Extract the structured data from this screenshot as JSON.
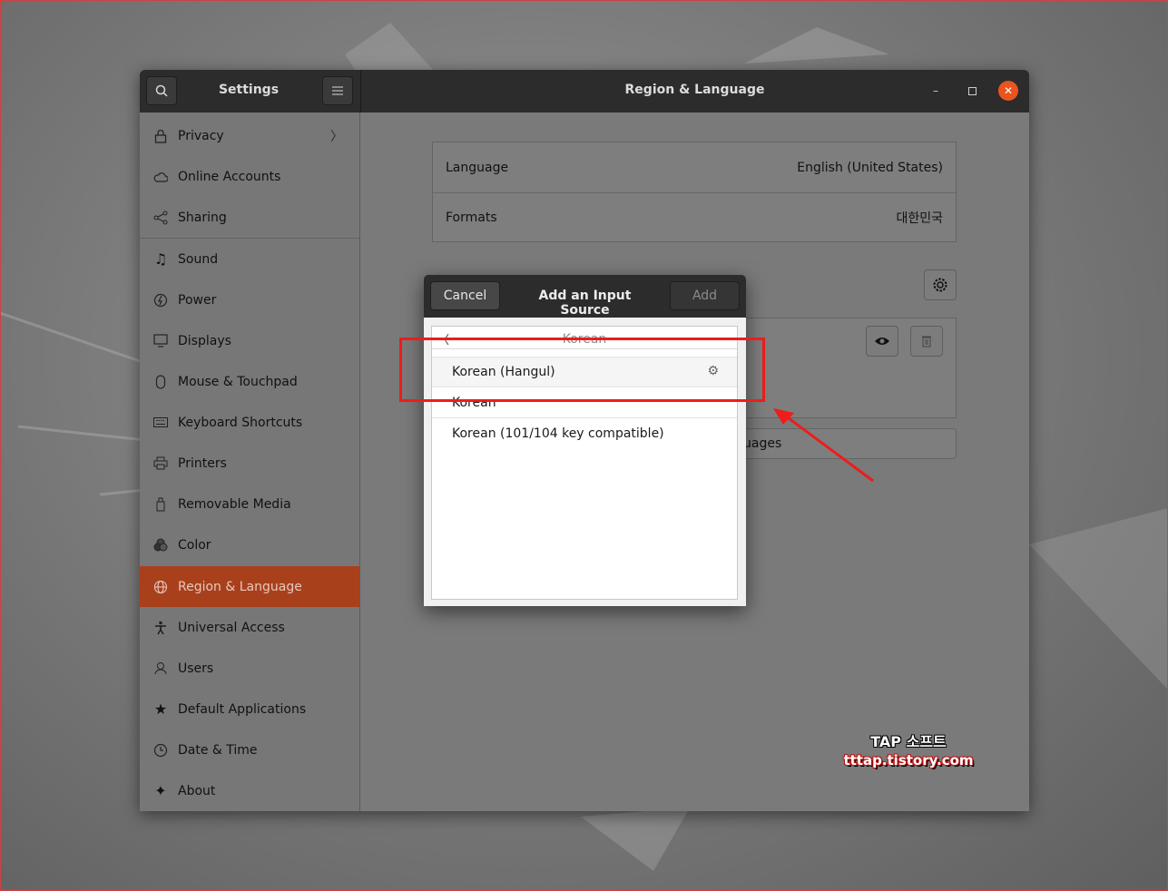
{
  "settings_window": {
    "sidebar_title": "Settings",
    "panel_title": "Region & Language",
    "window_controls": {
      "minimize_icon": "minimize-icon",
      "maximize_icon": "maximize-icon",
      "close_icon": "close-icon",
      "accent_color": "#e9541f"
    }
  },
  "sidebar": {
    "items": [
      {
        "label": "Privacy",
        "icon": "lock-icon",
        "has_chevron": true
      },
      {
        "label": "Online Accounts",
        "icon": "cloud-icon"
      },
      {
        "label": "Sharing",
        "icon": "share-icon"
      },
      {
        "label": "Sound",
        "icon": "music-note-icon"
      },
      {
        "label": "Power",
        "icon": "power-icon"
      },
      {
        "label": "Displays",
        "icon": "display-icon"
      },
      {
        "label": "Mouse & Touchpad",
        "icon": "mouse-icon"
      },
      {
        "label": "Keyboard Shortcuts",
        "icon": "keyboard-icon"
      },
      {
        "label": "Printers",
        "icon": "printer-icon"
      },
      {
        "label": "Removable Media",
        "icon": "usb-icon"
      },
      {
        "label": "Color",
        "icon": "color-icon"
      },
      {
        "label": "Region & Language",
        "icon": "globe-icon",
        "active": true
      },
      {
        "label": "Universal Access",
        "icon": "accessibility-icon"
      },
      {
        "label": "Users",
        "icon": "users-icon"
      },
      {
        "label": "Default Applications",
        "icon": "star-icon"
      },
      {
        "label": "Date & Time",
        "icon": "clock-icon"
      },
      {
        "label": "About",
        "icon": "sparkle-icon"
      }
    ],
    "active_color": "#a9401c"
  },
  "region_panel": {
    "language_label": "Language",
    "language_value": "English (United States)",
    "formats_label": "Formats",
    "formats_value": "대한민국",
    "manage_languages_partial": "uages"
  },
  "dialog": {
    "cancel_label": "Cancel",
    "title": "Add an Input Source",
    "add_label": "Add",
    "back_header": "Korean",
    "items": [
      {
        "label": "Korean (Hangul)",
        "has_settings": true
      },
      {
        "label": "Korean"
      },
      {
        "label": "Korean (101/104 key compatible)"
      }
    ]
  },
  "annotation": {
    "color": "#ee1c1c"
  },
  "watermark": {
    "line1": "TAP 소프트",
    "line2": "tttap.tistory.com"
  }
}
